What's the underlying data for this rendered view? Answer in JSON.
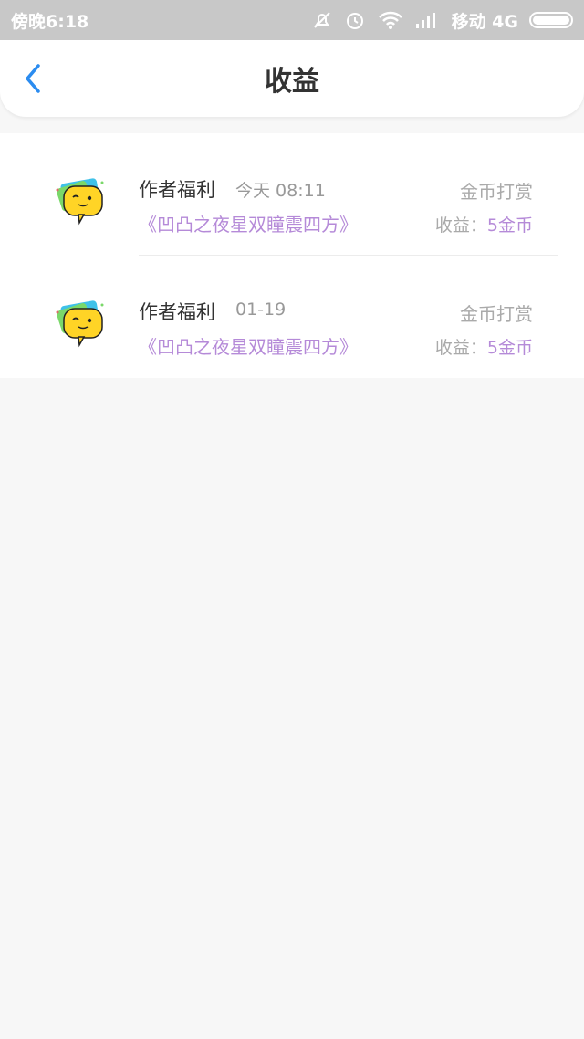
{
  "status_bar": {
    "time": "傍晚6:18",
    "carrier": "移动 4G"
  },
  "header": {
    "title": "收益"
  },
  "items": [
    {
      "name": "作者福利",
      "time": "今天 08:11",
      "type": "金币打赏",
      "book": "《凹凸之夜星双瞳震四方》",
      "earn_label": "收益：",
      "earn_value": "5金币"
    },
    {
      "name": "作者福利",
      "time": "01-19",
      "type": "金币打赏",
      "book": "《凹凸之夜星双瞳震四方》",
      "earn_label": "收益：",
      "earn_value": "5金币"
    }
  ],
  "colors": {
    "accent_purple": "#b58ad8",
    "back_arrow_blue": "#2b8cf0",
    "status_bar_bg": "#c8c8c8"
  }
}
